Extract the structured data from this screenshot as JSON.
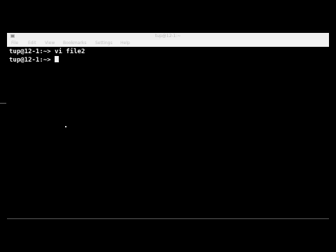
{
  "window": {
    "title": "tup@12-1:~"
  },
  "menu": {
    "items": [
      {
        "label": "File"
      },
      {
        "label": "Edit"
      },
      {
        "label": "View"
      },
      {
        "label": "Bookmarks"
      },
      {
        "label": "Settings"
      },
      {
        "label": "Help"
      }
    ]
  },
  "terminal": {
    "lines": [
      {
        "prompt": "tup@12-1:~>",
        "command": "vi file2"
      },
      {
        "prompt": "tup@12-1:~>",
        "command": ""
      }
    ]
  },
  "colors": {
    "background": "#000000",
    "text": "#f2f2f2",
    "titlebar": "#eeeeee",
    "menubar": "#f3f3f3"
  }
}
